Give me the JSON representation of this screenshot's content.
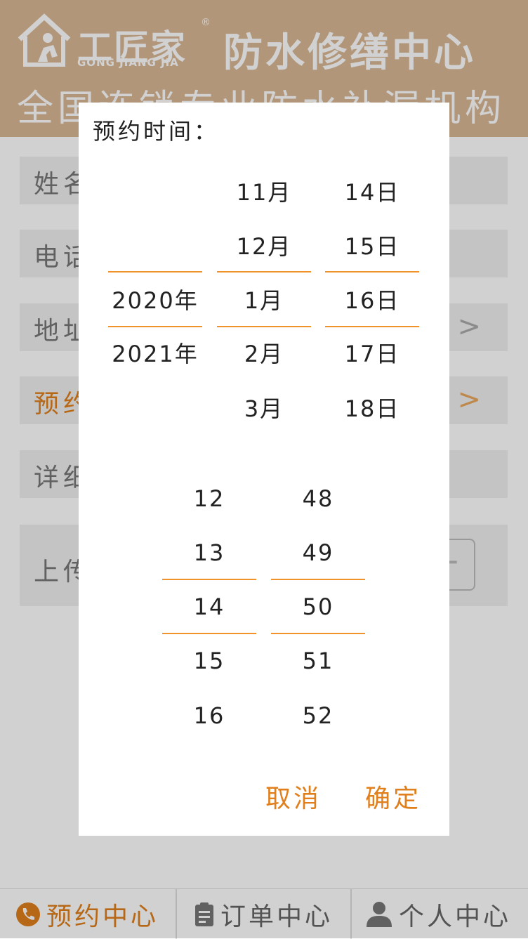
{
  "header": {
    "logo_cn": "工匠家",
    "logo_en": "GONG JIANG JIA",
    "logo_reg": "®",
    "title": "防水修缮中心",
    "subtitle": "全国连锁专业防水补漏机构"
  },
  "form": {
    "fields": [
      {
        "label": "姓名"
      },
      {
        "label": "电话"
      },
      {
        "label": "地址"
      },
      {
        "label": "预约"
      },
      {
        "label": "详细"
      },
      {
        "label": "上传"
      }
    ],
    "chevron": ">",
    "upload_symbol": "+"
  },
  "dialog": {
    "title": "预约时间：",
    "years": [
      "",
      "",
      "2020年",
      "2021年",
      ""
    ],
    "months": [
      "11月",
      "12月",
      "1月",
      "2月",
      "3月"
    ],
    "days": [
      "14日",
      "15日",
      "16日",
      "17日",
      "18日"
    ],
    "hours": [
      "12",
      "13",
      "14",
      "15",
      "16"
    ],
    "minutes": [
      "48",
      "49",
      "50",
      "51",
      "52"
    ],
    "cancel_label": "取消",
    "confirm_label": "确定"
  },
  "tabbar": {
    "tabs": [
      {
        "label": "预约中心",
        "icon": "phone-icon",
        "active": true
      },
      {
        "label": "订单中心",
        "icon": "clipboard-icon",
        "active": false
      },
      {
        "label": "个人中心",
        "icon": "user-icon",
        "active": false
      }
    ]
  },
  "colors": {
    "accent": "#e07f1c",
    "header_bg": "#d9b795",
    "selection_line": "#f0932b"
  }
}
